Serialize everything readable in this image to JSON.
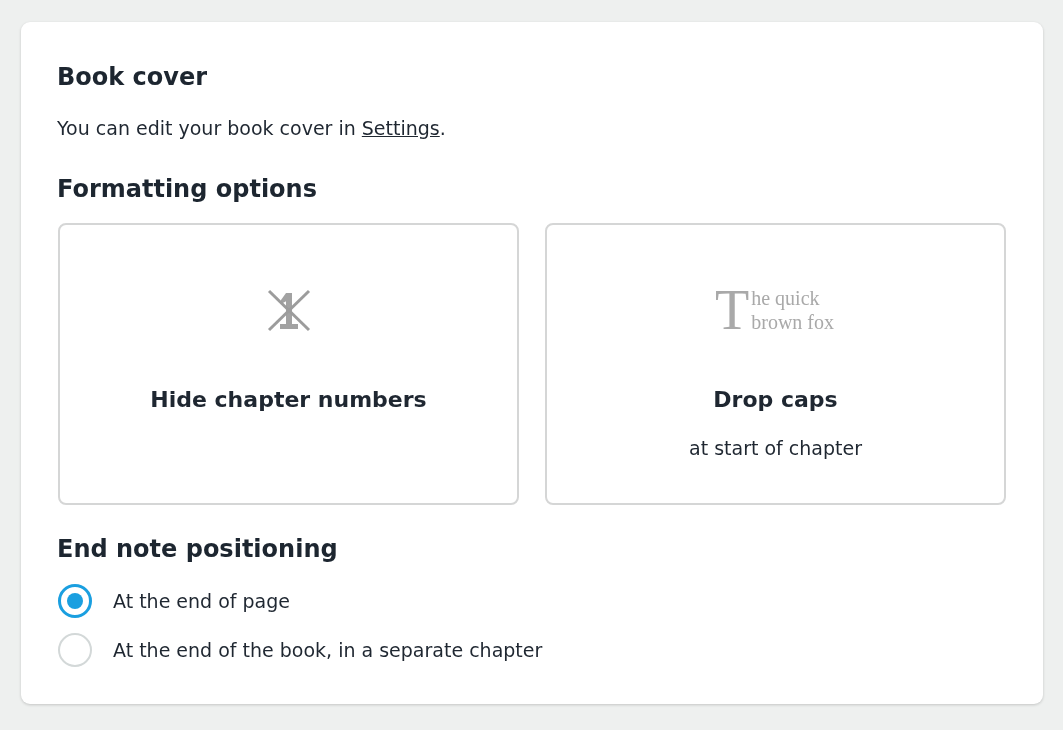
{
  "book_cover": {
    "title": "Book cover",
    "description": {
      "before": "You can edit your book cover in ",
      "link": "Settings",
      "after": "."
    }
  },
  "formatting": {
    "title": "Formatting options",
    "options": [
      {
        "kind": "hide_numbers",
        "label": "Hide chapter numbers",
        "selected": false
      },
      {
        "kind": "drop_caps",
        "sample": {
          "initial": "T",
          "lines": [
            "he quick",
            "brown fox"
          ]
        },
        "label": "Drop caps",
        "subtitle": "at start of chapter",
        "selected": false
      }
    ]
  },
  "end_notes": {
    "title": "End note positioning",
    "options": [
      {
        "label": "At the end of page",
        "selected": true
      },
      {
        "label": "At the end of the book, in a separate chapter",
        "selected": false
      }
    ]
  }
}
